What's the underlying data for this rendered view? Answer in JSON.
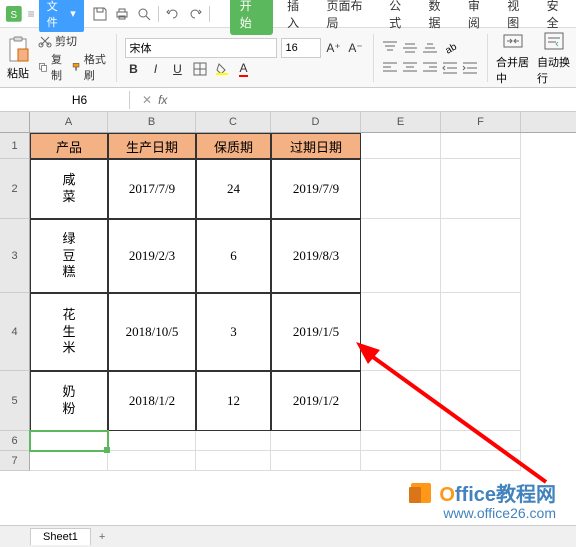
{
  "menu": {
    "file": "文件",
    "tabs": [
      "开始",
      "插入",
      "页面布局",
      "公式",
      "数据",
      "审阅",
      "视图",
      "安全"
    ],
    "active_tab": 0
  },
  "ribbon": {
    "paste": "粘贴",
    "cut": "剪切",
    "copy": "复制",
    "format_painter": "格式刷",
    "font_name": "宋体",
    "font_size": "16",
    "merge_center": "合并居中",
    "auto_wrap": "自动换行"
  },
  "namebox": {
    "cell_ref": "H6",
    "fx": "fx"
  },
  "columns": [
    "A",
    "B",
    "C",
    "D",
    "E",
    "F"
  ],
  "rows": [
    "1",
    "2",
    "3",
    "4",
    "5",
    "6",
    "7"
  ],
  "table": {
    "headers": [
      "产品",
      "生产日期",
      "保质期",
      "过期日期"
    ],
    "data": [
      {
        "product": "咸菜",
        "prod_date": "2017/7/9",
        "shelf": "24",
        "exp_date": "2019/7/9"
      },
      {
        "product": "绿豆糕",
        "prod_date": "2019/2/3",
        "shelf": "6",
        "exp_date": "2019/8/3"
      },
      {
        "product": "花生米",
        "prod_date": "2018/10/5",
        "shelf": "3",
        "exp_date": "2019/1/5"
      },
      {
        "product": "奶粉",
        "prod_date": "2018/1/2",
        "shelf": "12",
        "exp_date": "2019/1/2"
      }
    ]
  },
  "sheet_tabs": {
    "active": "Sheet1"
  },
  "watermark": {
    "brand": "Office教程网",
    "url": "www.office26.com"
  }
}
